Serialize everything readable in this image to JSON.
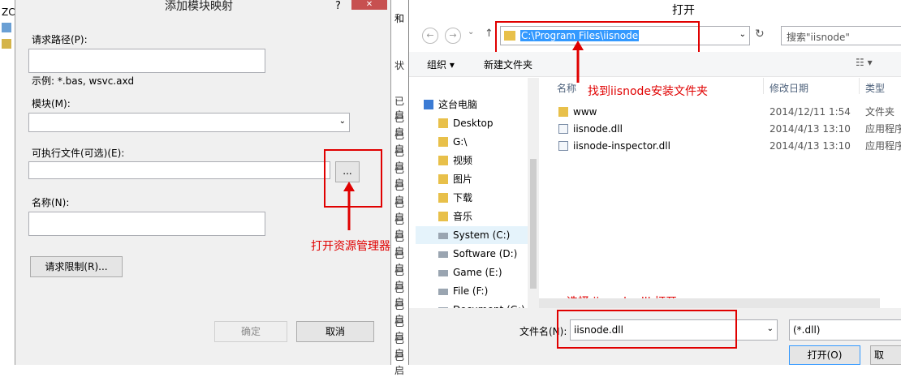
{
  "background_app": {
    "title_fragment": "ZC",
    "heading_fragment": "和",
    "status_label": "状",
    "rows": [
      "已启",
      "已启",
      "已启",
      "已启",
      "已启",
      "已启",
      "已启",
      "已启",
      "已启",
      "已启",
      "已启",
      "已启",
      "已启",
      "已启",
      "已启",
      "已启"
    ]
  },
  "module_dialog": {
    "title": "添加模块映射",
    "help": "?",
    "close": "✕",
    "request_path_label": "请求路径(P):",
    "request_path_value": "",
    "example_text": "示例: *.bas, wsvc.axd",
    "module_label": "模块(M):",
    "module_value": "",
    "executable_label": "可执行文件(可选)(E):",
    "executable_value": "",
    "browse_label": "...",
    "name_label": "名称(N):",
    "name_value": "",
    "restrictions_button": "请求限制(R)...",
    "ok_button": "确定",
    "cancel_button": "取消"
  },
  "open_dialog": {
    "title": "打开",
    "address_path": "C:\\Program Files\\iisnode",
    "search_placeholder": "搜索\"iisnode\"",
    "organize_label": "组织 ▾",
    "new_folder_label": "新建文件夹",
    "columns": {
      "name": "名称",
      "date": "修改日期",
      "type": "类型"
    },
    "tree": [
      {
        "label": "这台电脑",
        "icon": "computer-icon"
      },
      {
        "label": "Desktop",
        "icon": "folder-icon"
      },
      {
        "label": "G:\\",
        "icon": "folder-icon"
      },
      {
        "label": "视频",
        "icon": "folder-icon"
      },
      {
        "label": "图片",
        "icon": "folder-icon"
      },
      {
        "label": "下载",
        "icon": "folder-icon"
      },
      {
        "label": "音乐",
        "icon": "folder-icon"
      },
      {
        "label": "System (C:)",
        "icon": "drive-icon"
      },
      {
        "label": "Software (D:)",
        "icon": "drive-icon"
      },
      {
        "label": "Game (E:)",
        "icon": "drive-icon"
      },
      {
        "label": "File (F:)",
        "icon": "drive-icon"
      },
      {
        "label": "Document (G:)",
        "icon": "drive-icon"
      }
    ],
    "files": [
      {
        "name": "www",
        "date": "2014/12/11 1:54",
        "type": "文件夹",
        "icon": "folder-icon"
      },
      {
        "name": "iisnode.dll",
        "date": "2014/4/13 13:10",
        "type": "应用程序",
        "icon": "dll-icon"
      },
      {
        "name": "iisnode-inspector.dll",
        "date": "2014/4/13 13:10",
        "type": "应用程序",
        "icon": "dll-icon"
      }
    ],
    "filename_label": "文件名(N):",
    "filename_value": "iisnode.dll",
    "filter_value": "(*.dll)",
    "open_button": "打开(O)",
    "cancel_button": "取"
  },
  "annotations": {
    "find_folder": "找到iisnode安装文件夹",
    "open_explorer": "打开资源管理器",
    "select_open": "选择 iisnode.dll 打开"
  },
  "colors": {
    "annotation": "#e00000",
    "selection": "#3399ff",
    "window_bg": "#f0f0f0"
  }
}
